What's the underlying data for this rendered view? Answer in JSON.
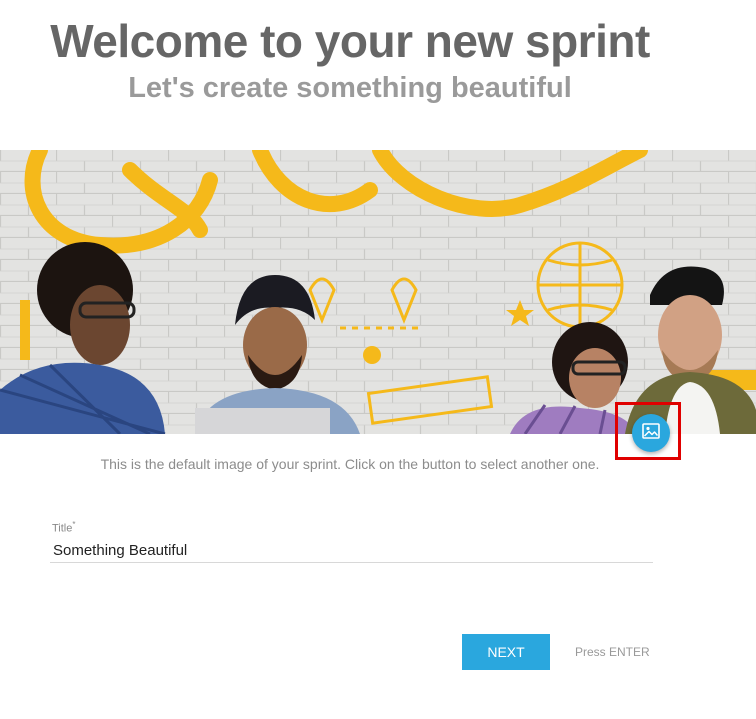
{
  "header": {
    "title": "Welcome to your new sprint",
    "subtitle": "Let's create something beautiful"
  },
  "hero": {
    "hint": "This is the default image of your sprint. Click on the button to select another one.",
    "change_image_icon": "image-icon",
    "accent_color": "#2aa7de",
    "graffiti_color": "#f5b91a",
    "highlight_color": "#e00000"
  },
  "form": {
    "title_label": "Title",
    "title_required_marker": "*",
    "title_value": "Something Beautiful"
  },
  "actions": {
    "next_label": "NEXT",
    "press_enter_hint": "Press ENTER"
  }
}
